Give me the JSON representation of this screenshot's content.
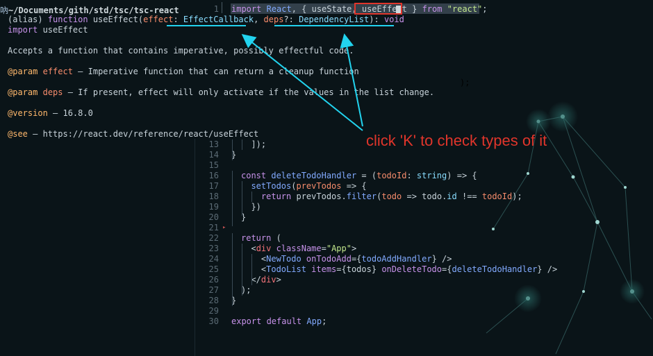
{
  "window": {
    "path": "~/Documents/gith/std/tsc/tsc-react",
    "app_icon": "terminal-icon"
  },
  "editor": {
    "line1_number": "1",
    "line1_tokens": [
      {
        "t": "import ",
        "c": "kw"
      },
      {
        "t": "React",
        "c": "fn"
      },
      {
        "t": ", { ",
        "c": "txt"
      },
      {
        "t": "useState",
        "c": "txt"
      },
      {
        "t": ", ",
        "c": "txt"
      },
      {
        "t": "useEffect",
        "c": "txt"
      },
      {
        "t": " } ",
        "c": "txt"
      },
      {
        "t": "from ",
        "c": "kw"
      },
      {
        "t": "\"react\"",
        "c": "str"
      },
      {
        "t": ";",
        "c": "txt"
      }
    ],
    "trailing_paren": ");",
    "lines": [
      {
        "n": "13",
        "tokens": [
          {
            "t": "  ]);",
            "c": "txt"
          }
        ]
      },
      {
        "n": "14",
        "tokens": [
          {
            "t": "}",
            "c": "txt"
          }
        ]
      },
      {
        "n": "15",
        "tokens": [
          {
            "t": "",
            "c": "txt"
          }
        ]
      },
      {
        "n": "16",
        "tokens": [
          {
            "t": "const ",
            "c": "kw"
          },
          {
            "t": "deleteTodoHandler",
            "c": "fn"
          },
          {
            "t": " = (",
            "c": "txt"
          },
          {
            "t": "todoId",
            "c": "var"
          },
          {
            "t": ": ",
            "c": "txt"
          },
          {
            "t": "string",
            "c": "prop"
          },
          {
            "t": ") => {",
            "c": "txt"
          }
        ]
      },
      {
        "n": "17",
        "tokens": [
          {
            "t": "  setTodos",
            "c": "fn"
          },
          {
            "t": "(",
            "c": "txt"
          },
          {
            "t": "prevTodos",
            "c": "var"
          },
          {
            "t": " => {",
            "c": "txt"
          }
        ]
      },
      {
        "n": "18",
        "tokens": [
          {
            "t": "    return ",
            "c": "kw"
          },
          {
            "t": "prevTodos",
            "c": "txt"
          },
          {
            "t": ".",
            "c": "txt"
          },
          {
            "t": "filter",
            "c": "fn"
          },
          {
            "t": "(",
            "c": "txt"
          },
          {
            "t": "todo",
            "c": "var"
          },
          {
            "t": " => ",
            "c": "txt"
          },
          {
            "t": "todo",
            "c": "txt"
          },
          {
            "t": ".",
            "c": "txt"
          },
          {
            "t": "id",
            "c": "prop"
          },
          {
            "t": " !== ",
            "c": "txt"
          },
          {
            "t": "todoId",
            "c": "var"
          },
          {
            "t": ");",
            "c": "txt"
          }
        ]
      },
      {
        "n": "19",
        "tokens": [
          {
            "t": "  })",
            "c": "txt"
          }
        ]
      },
      {
        "n": "20",
        "tokens": [
          {
            "t": "}",
            "c": "txt"
          }
        ]
      },
      {
        "n": "21",
        "tokens": [
          {
            "t": "",
            "c": "txt"
          }
        ]
      },
      {
        "n": "22",
        "tokens": [
          {
            "t": "return ",
            "c": "kw"
          },
          {
            "t": "(",
            "c": "txt"
          }
        ]
      },
      {
        "n": "23",
        "tokens": [
          {
            "t": "  <",
            "c": "txt"
          },
          {
            "t": "div ",
            "c": "tag"
          },
          {
            "t": "className",
            "c": "attr"
          },
          {
            "t": "=",
            "c": "txt"
          },
          {
            "t": "\"App\"",
            "c": "str"
          },
          {
            "t": ">",
            "c": "txt"
          }
        ]
      },
      {
        "n": "24",
        "tokens": [
          {
            "t": "    <",
            "c": "txt"
          },
          {
            "t": "NewTodo ",
            "c": "fn"
          },
          {
            "t": "onTodoAdd",
            "c": "attr"
          },
          {
            "t": "={",
            "c": "txt"
          },
          {
            "t": "todoAddHandler",
            "c": "fn"
          },
          {
            "t": "} />",
            "c": "txt"
          }
        ]
      },
      {
        "n": "25",
        "tokens": [
          {
            "t": "    <",
            "c": "txt"
          },
          {
            "t": "TodoList ",
            "c": "fn"
          },
          {
            "t": "items",
            "c": "attr"
          },
          {
            "t": "={",
            "c": "txt"
          },
          {
            "t": "todos",
            "c": "txt"
          },
          {
            "t": "} ",
            "c": "txt"
          },
          {
            "t": "onDeleteTodo",
            "c": "attr"
          },
          {
            "t": "={",
            "c": "txt"
          },
          {
            "t": "deleteTodoHandler",
            "c": "fn"
          },
          {
            "t": "} />",
            "c": "txt"
          }
        ]
      },
      {
        "n": "26",
        "tokens": [
          {
            "t": "  </",
            "c": "txt"
          },
          {
            "t": "div",
            "c": "tag"
          },
          {
            "t": ">",
            "c": "txt"
          }
        ]
      },
      {
        "n": "27",
        "tokens": [
          {
            "t": ");",
            "c": "txt"
          }
        ]
      },
      {
        "n": "28",
        "tokens": [
          {
            "t": "}",
            "c": "txt"
          }
        ]
      },
      {
        "n": "29",
        "tokens": [
          {
            "t": "",
            "c": "txt"
          }
        ]
      },
      {
        "n": "30",
        "tokens": [
          {
            "t": "export default ",
            "c": "kw"
          },
          {
            "t": "App",
            "c": "fn"
          },
          {
            "t": ";",
            "c": "txt"
          }
        ]
      }
    ]
  },
  "hover": {
    "signature": [
      {
        "t": "(alias) ",
        "c": "txt"
      },
      {
        "t": "function ",
        "c": "kw"
      },
      {
        "t": "useEffect",
        "c": "txt"
      },
      {
        "t": "(",
        "c": "txt"
      },
      {
        "t": "effect",
        "c": "var"
      },
      {
        "t": ": ",
        "c": "txt"
      },
      {
        "t": "EffectCallback",
        "c": "prop"
      },
      {
        "t": ", ",
        "c": "txt"
      },
      {
        "t": "deps",
        "c": "var"
      },
      {
        "t": "?: ",
        "c": "txt"
      },
      {
        "t": "DependencyList",
        "c": "prop"
      },
      {
        "t": "): ",
        "c": "txt"
      },
      {
        "t": "void",
        "c": "kw"
      }
    ],
    "import_line": "import useEffect",
    "description": "Accepts a function that contains imperative, possibly effectful code.",
    "param1_tag": "@param",
    "param1_name": "effect",
    "param1_text": " — Imperative function that can return a cleanup function",
    "param2_tag": "@param",
    "param2_name": "deps",
    "param2_text": " — If present, effect will only activate if the values in the list change.",
    "version_tag": "@version",
    "version_text": " — 16.8.0",
    "see_tag": "@see",
    "see_text": " — https://react.dev/reference/react/useEffect"
  },
  "annotation": {
    "text": "click 'K' to check types of it",
    "color": "#e0352b",
    "arrow_color": "#22d3ee"
  }
}
